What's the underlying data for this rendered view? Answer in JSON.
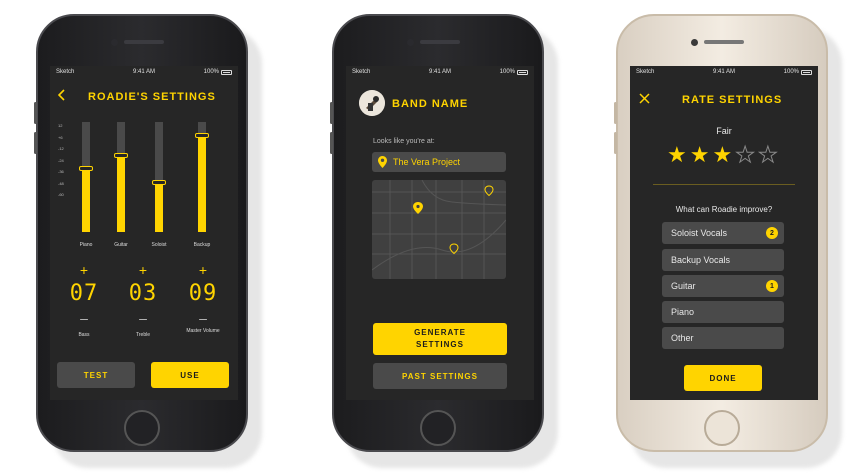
{
  "status": {
    "carrier": "Sketch",
    "time": "9:41 AM",
    "battery": "100%"
  },
  "accent": "#ffd400",
  "screen1": {
    "title": "ROADIE'S SETTINGS",
    "back_icon": "chevron-left-icon",
    "scale_labels": [
      "12",
      "+6",
      "-12",
      "-24",
      "-36",
      "-48",
      "-60"
    ],
    "sliders": [
      {
        "label": "Piano",
        "level": 0.57
      },
      {
        "label": "Guitar",
        "level": 0.69
      },
      {
        "label": "Soloist",
        "level": 0.45
      },
      {
        "label": "Backup",
        "level": 0.87
      }
    ],
    "knobs": [
      {
        "value": "07",
        "label": "Bass"
      },
      {
        "value": "03",
        "label": "Treble"
      },
      {
        "value": "09",
        "label": "Master Volume"
      }
    ],
    "plus": "+",
    "minus": "–",
    "test_label": "TEST",
    "use_label": "USE"
  },
  "screen2": {
    "band_name": "BAND NAME",
    "location_prompt": "Looks like you're at:",
    "venue": "The Vera Project",
    "generate_label": "GENERATE SETTINGS",
    "past_label": "PAST SETTINGS"
  },
  "screen3": {
    "title": "RATE SETTINGS",
    "close_icon": "close-icon",
    "rating_text": "Fair",
    "rating": 3,
    "rating_max": 5,
    "question": "What can Roadie improve?",
    "options": [
      {
        "label": "Soloist Vocals",
        "badge": "2"
      },
      {
        "label": "Backup Vocals",
        "badge": ""
      },
      {
        "label": "Guitar",
        "badge": "1"
      },
      {
        "label": "Piano",
        "badge": ""
      },
      {
        "label": "Other",
        "badge": ""
      }
    ],
    "done_label": "DONE"
  }
}
